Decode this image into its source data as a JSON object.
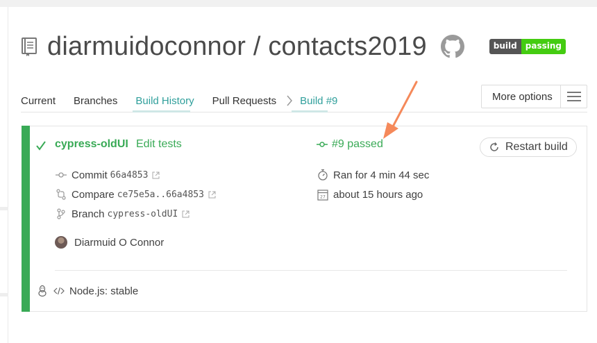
{
  "repo": {
    "owner": "diarmuidoconnor",
    "separator": " / ",
    "name": "contacts2019",
    "badge_left": "build",
    "badge_right": "passing"
  },
  "tabs": [
    {
      "label": "Current"
    },
    {
      "label": "Branches"
    },
    {
      "label": "Build History"
    },
    {
      "label": "Pull Requests"
    },
    {
      "label": "Build #9"
    }
  ],
  "more_options": {
    "label": "More options"
  },
  "build": {
    "branch": "cypress-oldUI",
    "commit_message": "Edit tests",
    "status": "#9 passed",
    "restart_label": "Restart build",
    "commit_label": "Commit",
    "commit_sha": "66a4853",
    "compare_label": "Compare",
    "compare_range": "ce75e5a..66a4853",
    "branch_label": "Branch",
    "branch_value": "cypress-oldUI",
    "author": "Diarmuid O Connor",
    "duration": "Ran for 4 min 44 sec",
    "finished": "about 15 hours ago",
    "language": "Node.js: stable"
  },
  "icons": {
    "repo": "book-icon",
    "github": "github-icon",
    "check": "check-icon",
    "commit": "commit-icon",
    "compare": "compare-icon",
    "branch": "branch-icon",
    "stopwatch": "stopwatch-icon",
    "calendar": "calendar-icon",
    "linux": "linux-icon",
    "code": "code-icon",
    "restart": "restart-icon",
    "external": "external-link-icon"
  },
  "colors": {
    "passed": "#39aa56",
    "active_tab": "#2f9f9b",
    "annotation_arrow": "#f5895a",
    "badge_pass": "#44cc11"
  }
}
